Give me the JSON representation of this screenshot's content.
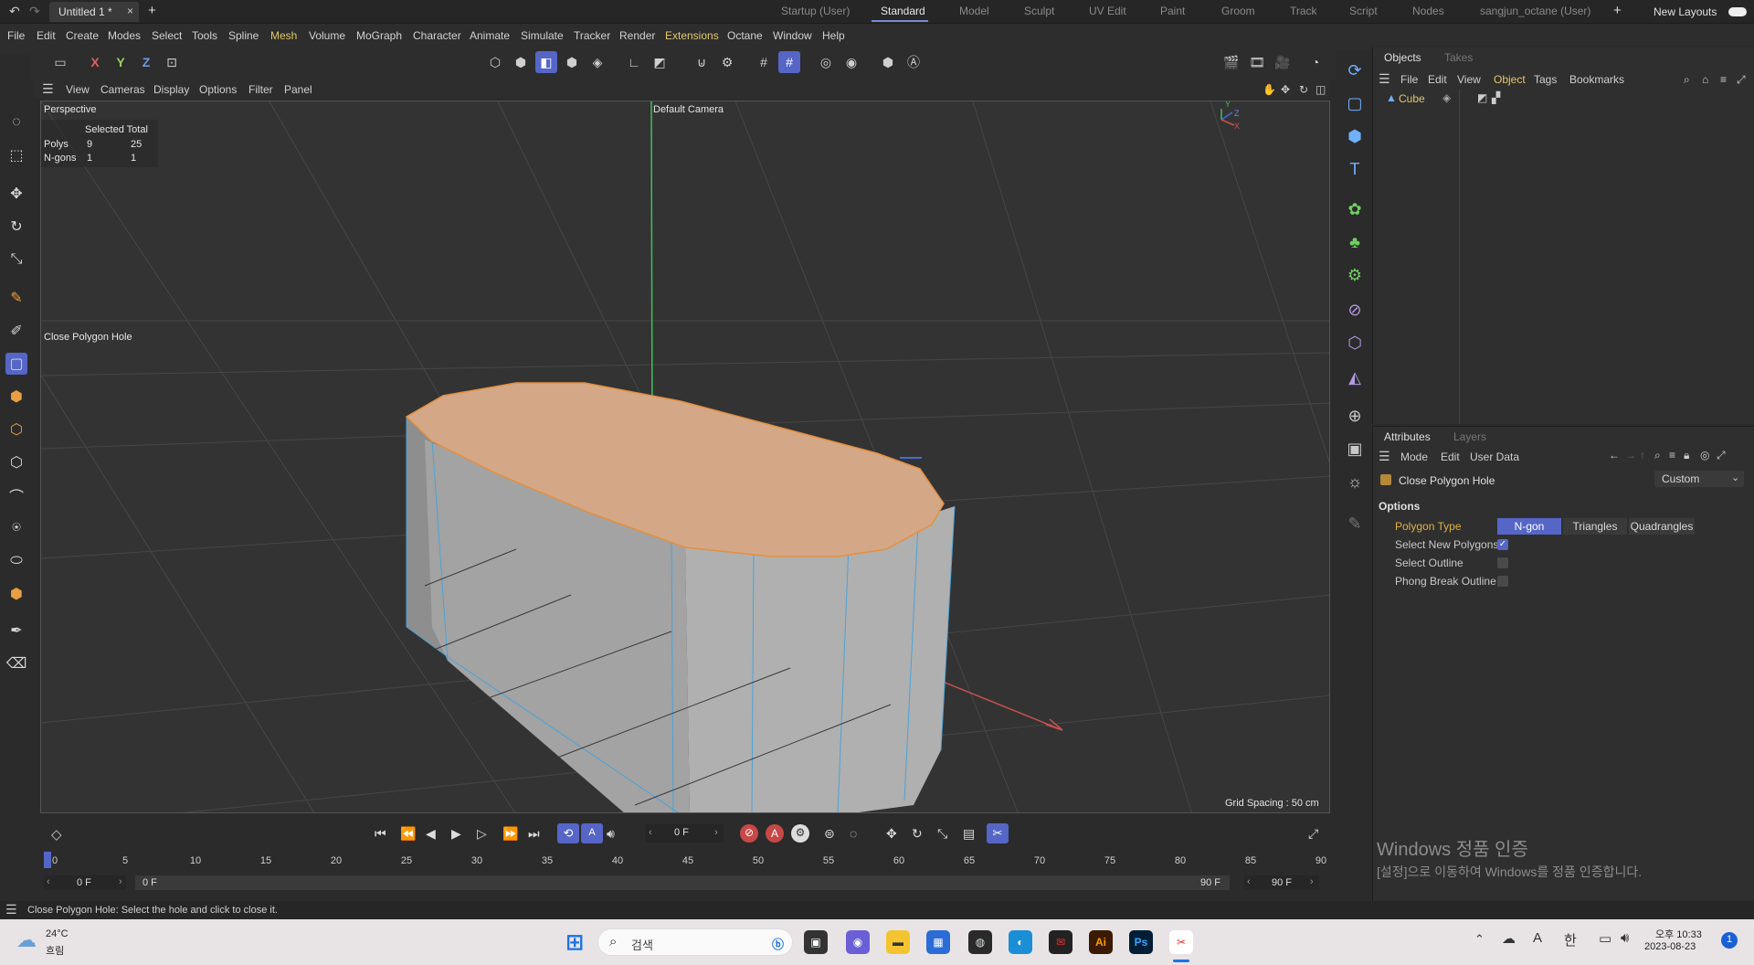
{
  "titlebar": {
    "doc_tab": "Untitled 1 *",
    "doc_close": "×",
    "add_tab": "+",
    "layouts": [
      "Startup (User)",
      "Standard",
      "Model",
      "Sculpt",
      "UV Edit",
      "Paint",
      "Groom",
      "Track",
      "Script",
      "Nodes",
      "sangjun_octane (User)"
    ],
    "active_layout": "Standard",
    "add_layout": "+",
    "new_layouts": "New Layouts"
  },
  "menu": [
    "File",
    "Edit",
    "Create",
    "Modes",
    "Select",
    "Tools",
    "Spline",
    "Mesh",
    "Volume",
    "MoGraph",
    "Character",
    "Animate",
    "Simulate",
    "Tracker",
    "Render",
    "Extensions",
    "Octane",
    "Window",
    "Help"
  ],
  "toolbar": {
    "axis_x": "X",
    "axis_y": "Y",
    "axis_z": "Z"
  },
  "viewport_menu": [
    "View",
    "Cameras",
    "Display",
    "Options",
    "Filter",
    "Panel"
  ],
  "viewport": {
    "name": "Perspective",
    "camera": "Default Camera",
    "hud_header": "Selected Total",
    "hud_rows": [
      {
        "label": "Polys",
        "selected": "9",
        "total": "25"
      },
      {
        "label": "N-gons",
        "selected": "1",
        "total": "1"
      }
    ],
    "tool_label": "Close Polygon Hole",
    "grid_spacing": "Grid Spacing : 50 cm",
    "axis_labels": {
      "y": "Y",
      "z": "Z",
      "x": "X"
    }
  },
  "objects_panel": {
    "tabs": [
      "Objects",
      "Takes"
    ],
    "menu": [
      "File",
      "Edit",
      "View",
      "Object",
      "Tags",
      "Bookmarks"
    ],
    "active_menu": "Object",
    "object_name": "Cube"
  },
  "attributes_panel": {
    "tabs": [
      "Attributes",
      "Layers"
    ],
    "menu": [
      "Mode",
      "Edit",
      "User Data"
    ],
    "tool_name": "Close Polygon Hole",
    "preset": "Custom",
    "section": "Options",
    "polygon_type_label": "Polygon Type",
    "polygon_types": [
      "N-gon",
      "Triangles",
      "Quadrangles"
    ],
    "polygon_type_selected": "N-gon",
    "options": [
      {
        "label": "Select New Polygons",
        "checked": true
      },
      {
        "label": "Select Outline",
        "checked": false
      },
      {
        "label": "Phong Break Outline",
        "checked": false
      }
    ]
  },
  "timeline": {
    "current_frame": "0 F",
    "ticks": [
      "0",
      "5",
      "10",
      "15",
      "20",
      "25",
      "30",
      "35",
      "40",
      "45",
      "50",
      "55",
      "60",
      "65",
      "70",
      "75",
      "80",
      "85",
      "90"
    ],
    "start_field": "0 F",
    "range_start": "0 F",
    "range_end": "90 F",
    "end_field": "90 F"
  },
  "status": "Close Polygon Hole: Select the hole and click to close it.",
  "watermark": {
    "title": "Windows 정품 인증",
    "subtitle": "[설정]으로 이동하여 Windows를 정품 인증합니다."
  },
  "taskbar": {
    "weather_temp": "24°C",
    "weather_text": "흐림",
    "search_placeholder": "검색",
    "ime_a": "A",
    "ime_han": "한",
    "time": "오후 10:33",
    "date": "2023-08-23",
    "notif_count": "1",
    "app_ai": "Ai",
    "app_ps": "Ps"
  }
}
